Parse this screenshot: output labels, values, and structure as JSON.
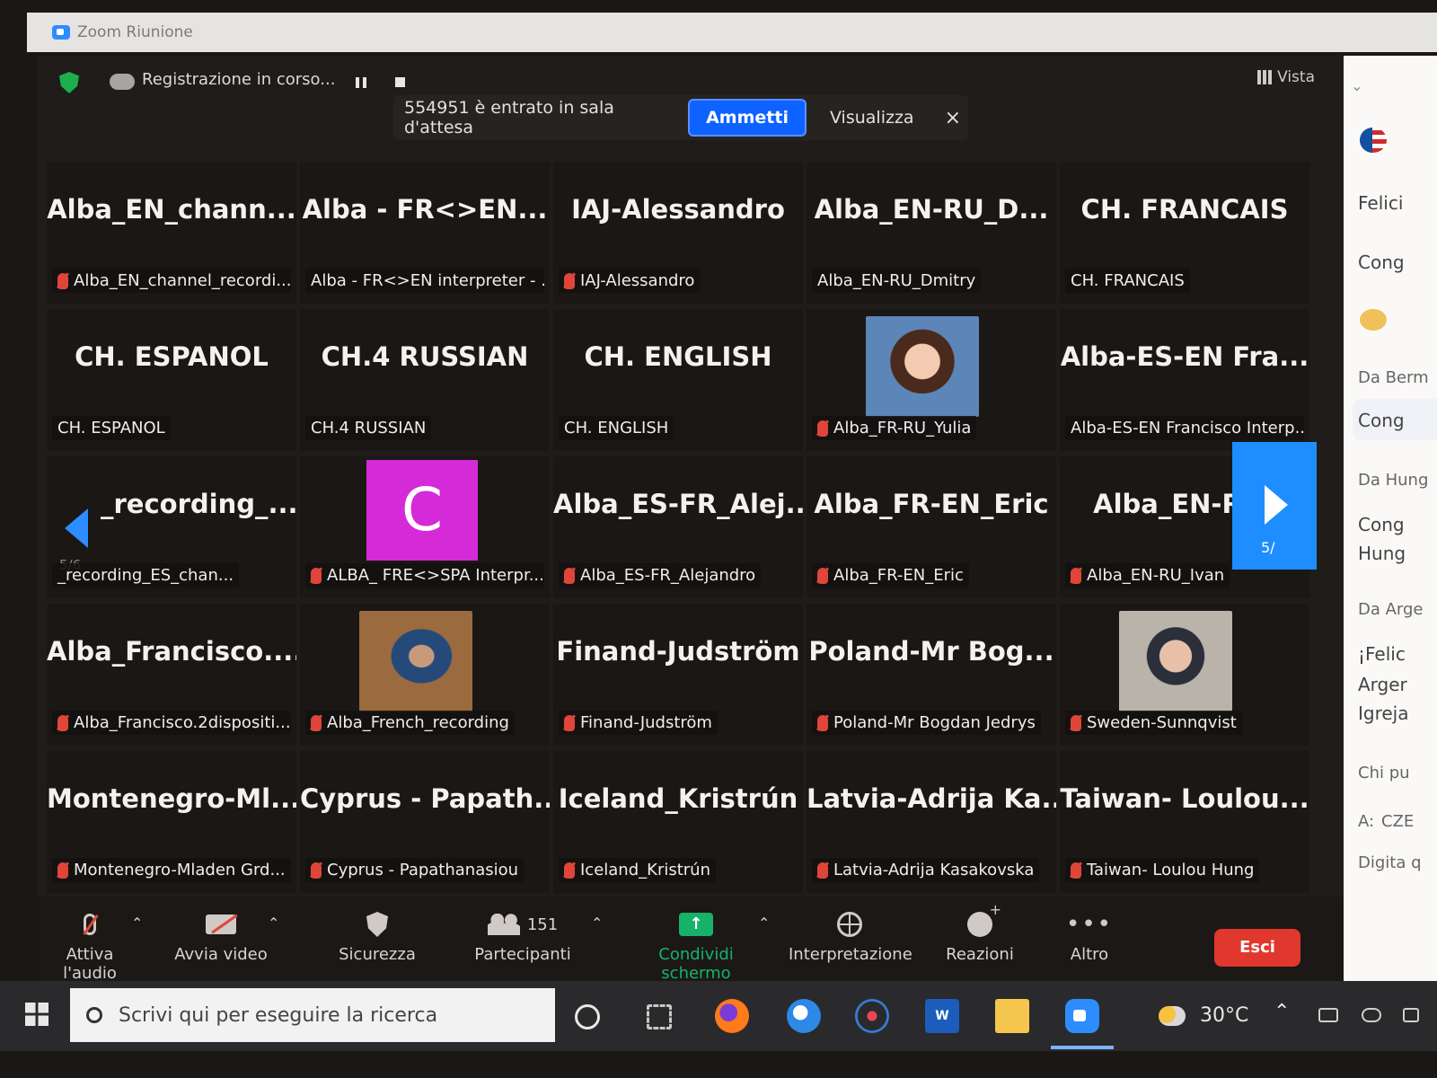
{
  "window": {
    "title": "Zoom Riunione"
  },
  "topbar": {
    "recording": "Registrazione in corso...",
    "view_label": "Vista"
  },
  "notice": {
    "message": "554951 è entrato in sala d'attesa",
    "admit": "Ammetti",
    "view": "Visualizza",
    "close": "×"
  },
  "tiles": [
    {
      "big": "Alba_EN_chann...",
      "name": "Alba_EN_channel_recordi...",
      "muted": true
    },
    {
      "big": "Alba - FR<>EN...",
      "name": "Alba - FR<>EN interpreter - ...",
      "muted": false
    },
    {
      "big": "IAJ-Alessandro",
      "name": "IAJ-Alessandro",
      "muted": true
    },
    {
      "big": "Alba_EN-RU_D...",
      "name": "Alba_EN-RU_Dmitry",
      "muted": false
    },
    {
      "big": "CH. FRANCAIS",
      "name": "CH. FRANCAIS",
      "muted": false
    },
    {
      "big": "CH. ESPANOL",
      "name": "CH. ESPANOL",
      "muted": false
    },
    {
      "big": "CH.4 RUSSIAN",
      "name": "CH.4 RUSSIAN",
      "muted": false
    },
    {
      "big": "CH. ENGLISH",
      "name": "CH. ENGLISH",
      "muted": false
    },
    {
      "big": "",
      "name": "Alba_FR-RU_Yulia",
      "muted": true,
      "photo": "a"
    },
    {
      "big": "Alba-ES-EN Fra...",
      "name": "Alba-ES-EN Francisco Interp...",
      "muted": false
    },
    {
      "big": "_recording_...",
      "name": "_recording_ES_chan...",
      "muted": false
    },
    {
      "big": "",
      "name": "ALBA_ FRE<>SPA Interpr...",
      "muted": true,
      "avatar": "C"
    },
    {
      "big": "Alba_ES-FR_Alej...",
      "name": "Alba_ES-FR_Alejandro",
      "muted": true
    },
    {
      "big": "Alba_FR-EN_Eric",
      "name": "Alba_FR-EN_Eric",
      "muted": true
    },
    {
      "big": "Alba_EN-RU_",
      "name": "Alba_EN-RU_Ivan",
      "muted": true
    },
    {
      "big": "Alba_Francisco....",
      "name": "Alba_Francisco.2dispositi...",
      "muted": true
    },
    {
      "big": "",
      "name": "Alba_French_recording",
      "muted": true,
      "photo": "b"
    },
    {
      "big": "Finand-Judström",
      "name": "Finand-Judström",
      "muted": true
    },
    {
      "big": "Poland-Mr Bog...",
      "name": "Poland-Mr Bogdan Jedrys",
      "muted": true
    },
    {
      "big": "",
      "name": "Sweden-Sunnqvist",
      "muted": true,
      "photo": "c"
    },
    {
      "big": "Montenegro-Ml...",
      "name": "Montenegro-Mladen Grd...",
      "muted": true
    },
    {
      "big": "Cyprus - Papath...",
      "name": "Cyprus - Papathanasiou",
      "muted": true
    },
    {
      "big": "Iceland_Kristrún",
      "name": "Iceland_Kristrún",
      "muted": true
    },
    {
      "big": "Latvia-Adrija Ka...",
      "name": "Latvia-Adrija Kasakovska",
      "muted": true
    },
    {
      "big": "Taiwan- Loulou...",
      "name": "Taiwan- Loulou Hung",
      "muted": true
    }
  ],
  "paging": {
    "left_page": "5/6",
    "right_page": "5/"
  },
  "toolbar": {
    "audio": "Attiva l'audio",
    "video": "Avvia video",
    "security": "Sicurezza",
    "participants": "Partecipanti",
    "participants_count": "151",
    "share": "Condividi schermo",
    "interpretation": "Interpretazione",
    "reactions": "Reazioni",
    "more": "Altro",
    "leave": "Esci",
    "share_color": "#17b26a",
    "leave_color": "#e0382d"
  },
  "chat": {
    "lines": [
      "Felici",
      "Cong",
      "Da Berm",
      "Cong",
      "Da Hung",
      "Cong",
      "Hung",
      "Da Arge",
      "¡Felic",
      "Arger",
      "Igreja",
      "Chi pu",
      "A:",
      "CZE",
      "Digita q"
    ]
  },
  "taskbar": {
    "search_placeholder": "Scrivi qui per eseguire la ricerca",
    "temperature": "30°C"
  }
}
